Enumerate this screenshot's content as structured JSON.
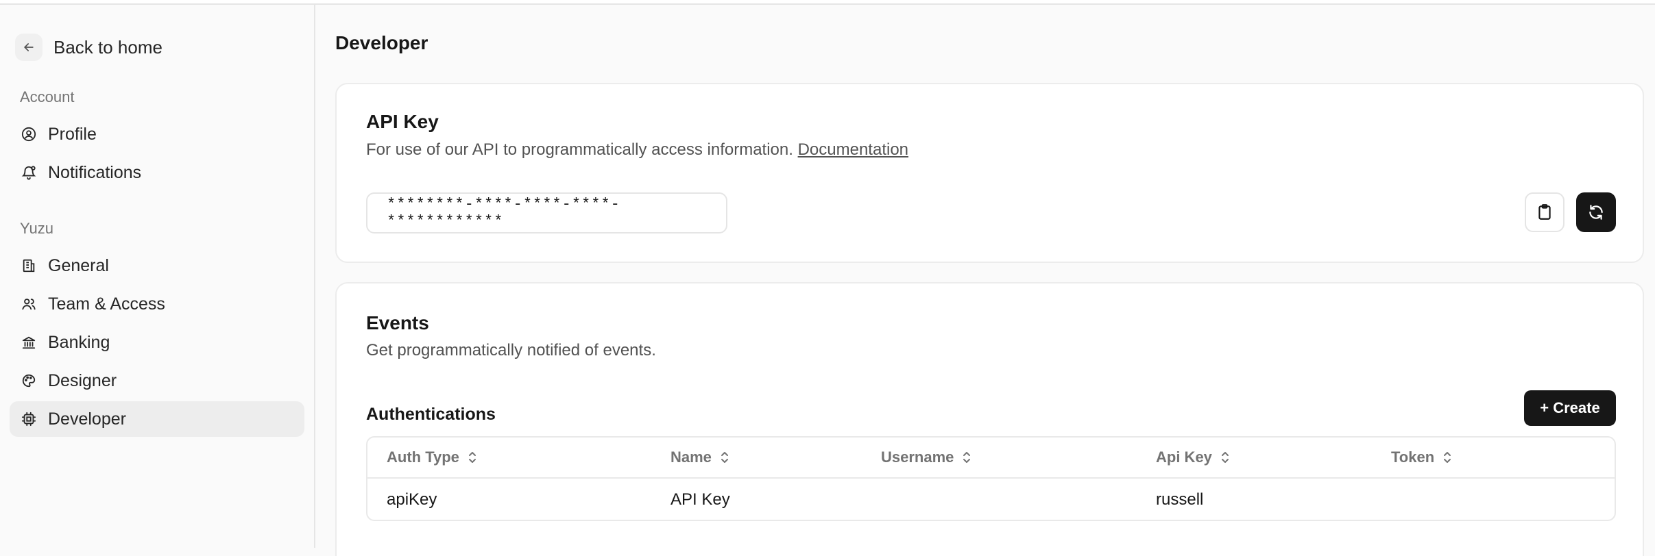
{
  "sidebar": {
    "back_label": "Back to home",
    "sections": [
      {
        "label": "Account",
        "items": [
          {
            "label": "Profile",
            "icon": "user-circle-icon"
          },
          {
            "label": "Notifications",
            "icon": "bell-icon"
          }
        ]
      },
      {
        "label": "Yuzu",
        "items": [
          {
            "label": "General",
            "icon": "building-icon"
          },
          {
            "label": "Team & Access",
            "icon": "users-icon"
          },
          {
            "label": "Banking",
            "icon": "bank-icon"
          },
          {
            "label": "Designer",
            "icon": "palette-icon"
          },
          {
            "label": "Developer",
            "icon": "chip-icon",
            "active": true
          }
        ]
      }
    ]
  },
  "page": {
    "title": "Developer"
  },
  "api_key_card": {
    "title": "API Key",
    "description": "For use of our API to programmatically access information.",
    "doc_link": "Documentation",
    "masked_key": "********-****-****-****-************",
    "copy_icon": "clipboard-icon",
    "regenerate_icon": "refresh-icon"
  },
  "events_card": {
    "title": "Events",
    "description": "Get programmatically notified of events.",
    "auth_heading": "Authentications",
    "create_label": "+ Create",
    "columns": [
      "Auth Type",
      "Name",
      "Username",
      "Api Key",
      "Token"
    ],
    "rows": [
      [
        "apiKey",
        "API Key",
        "",
        "russell",
        ""
      ]
    ]
  },
  "colors": {
    "accent_dark": "#171717",
    "muted": "#737373",
    "border": "#e5e5e5"
  }
}
